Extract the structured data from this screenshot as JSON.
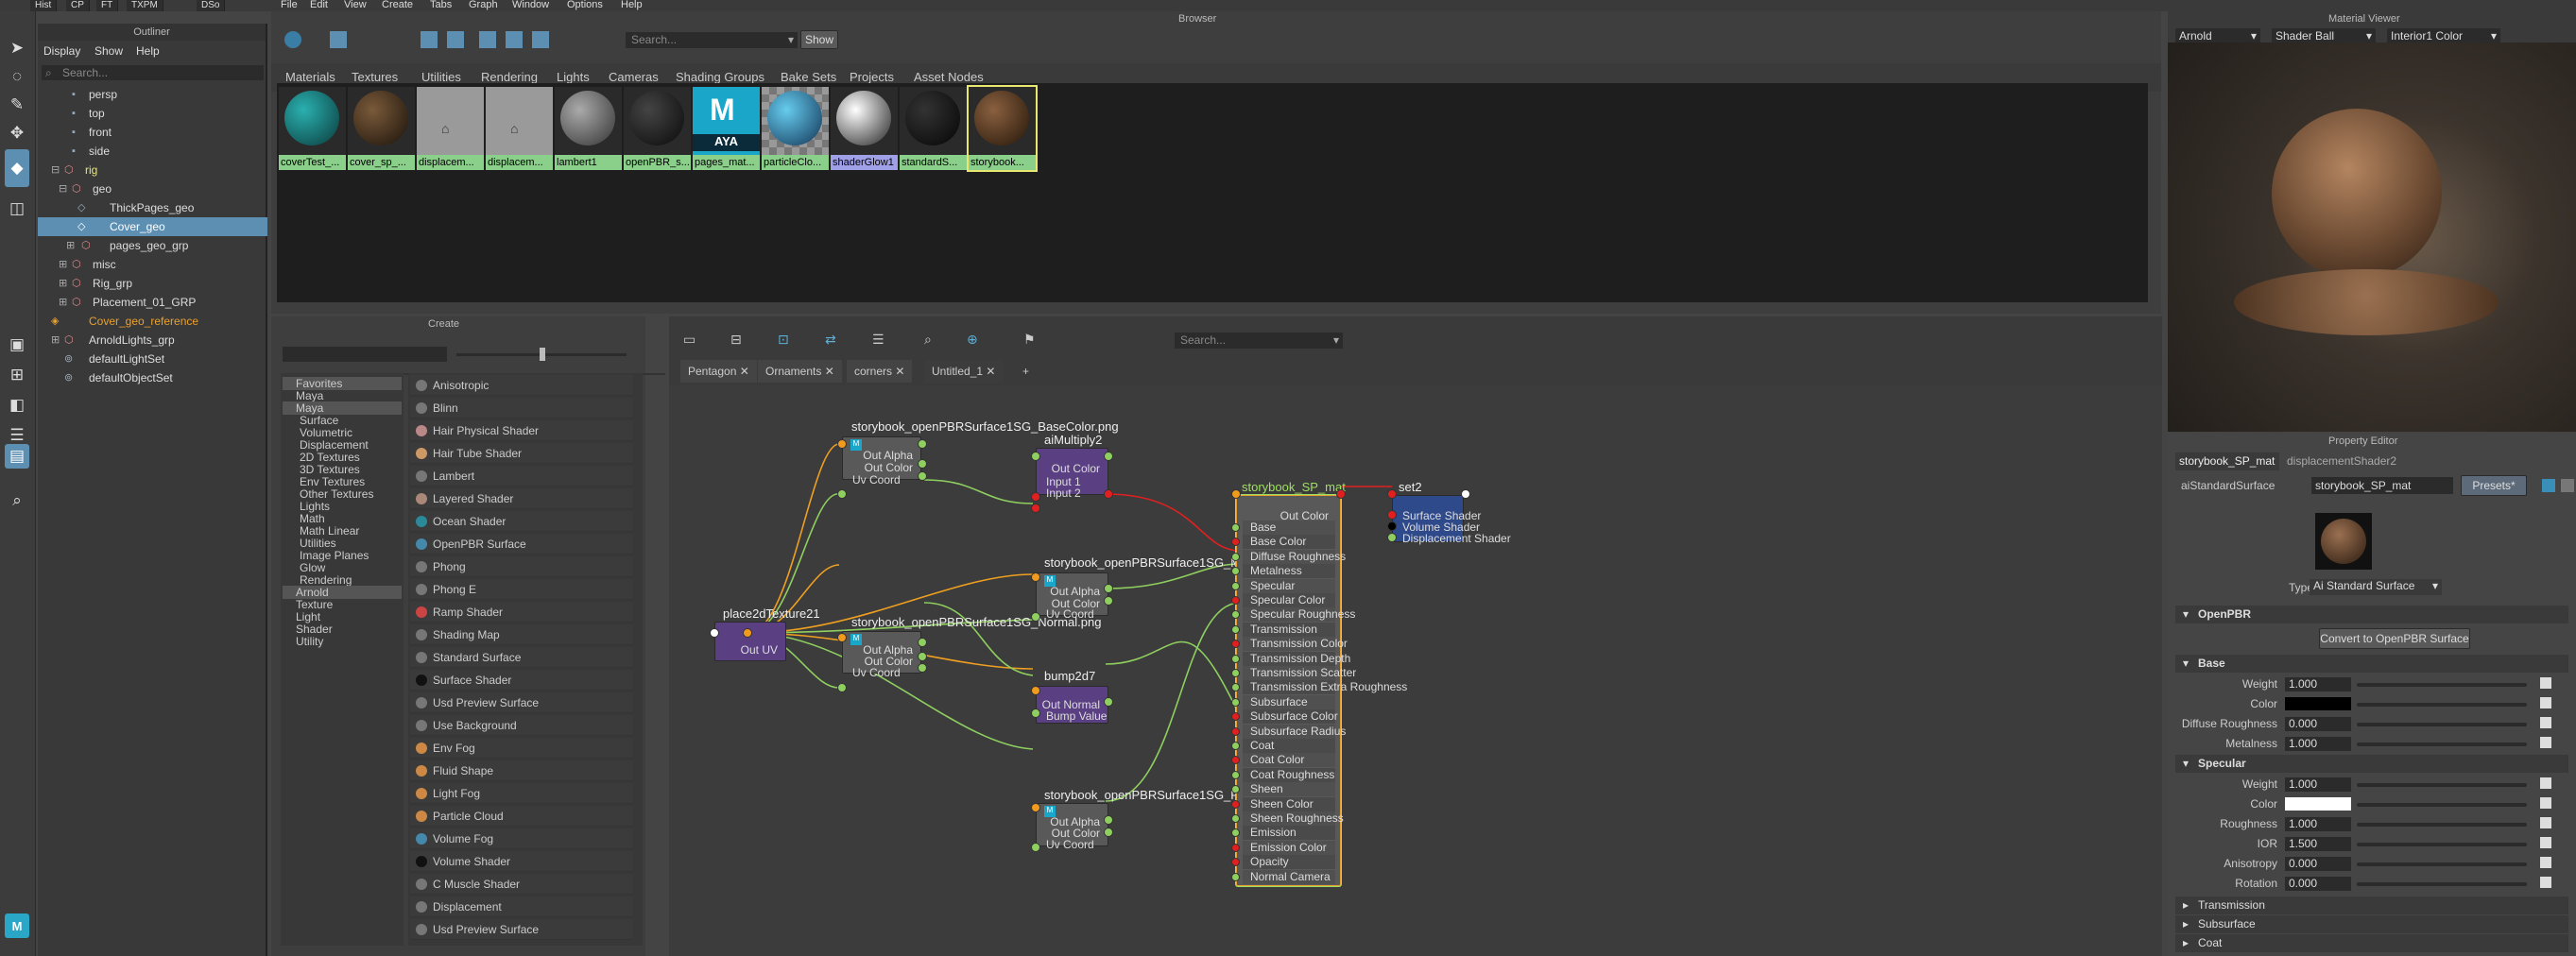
{
  "app": {
    "menu": [
      "File",
      "Edit",
      "View",
      "Create",
      "Tabs",
      "Graph",
      "Window",
      "Options",
      "Help"
    ],
    "shelf_tabs": [
      "Hist",
      "CP",
      "FT",
      "TXPM",
      "DSo"
    ]
  },
  "outliner": {
    "title": "Outliner",
    "menu": [
      "Display",
      "Show",
      "Help"
    ],
    "search_placeholder": "Search...",
    "items": [
      "persp",
      "top",
      "front",
      "side",
      "rig",
      "geo",
      "ThickPages_geo",
      "Cover_geo",
      "pages_geo_grp",
      "misc",
      "Rig_grp",
      "Placement_01_GRP",
      "Cover_geo_reference",
      "ArnoldLights_grp",
      "defaultLightSet",
      "defaultObjectSet"
    ]
  },
  "browser": {
    "title": "Browser",
    "search_placeholder": "Search...",
    "show_label": "Show",
    "tabs": [
      "Materials",
      "Textures",
      "Utilities",
      "Rendering",
      "Lights",
      "Cameras",
      "Shading Groups",
      "Bake Sets",
      "Projects",
      "Asset Nodes"
    ],
    "swatches": [
      "coverTest_...",
      "cover_sp_...",
      "displacem...",
      "displacem...",
      "lambert1",
      "openPBR_s...",
      "pages_mat...",
      "particleClo...",
      "shaderGlow1",
      "standardS...",
      "storybook..."
    ],
    "aya_label": "AYA"
  },
  "create": {
    "title": "Create",
    "tree": [
      "Favorites",
      "Maya",
      "Surface",
      "Volumetric",
      "Displacement",
      "2D Textures",
      "3D Textures",
      "Env Textures",
      "Other Textures",
      "Lights",
      "Math",
      "Math Linear",
      "Utilities",
      "Image Planes",
      "Glow",
      "Rendering",
      "Arnold",
      "Texture",
      "Light",
      "Shader",
      "Utility"
    ],
    "list": [
      "Anisotropic",
      "Blinn",
      "Hair Physical Shader",
      "Hair Tube Shader",
      "Lambert",
      "Layered Shader",
      "Ocean Shader",
      "OpenPBR Surface",
      "Phong",
      "Phong E",
      "Ramp Shader",
      "Shading Map",
      "Standard Surface",
      "Surface Shader",
      "Usd Preview Surface",
      "Use Background",
      "Env Fog",
      "Fluid Shape",
      "Light Fog",
      "Particle Cloud",
      "Volume Fog",
      "Volume Shader",
      "C Muscle Shader",
      "Displacement",
      "Usd Preview Surface"
    ]
  },
  "editor": {
    "search_placeholder": "Search...",
    "tabs": [
      "Pentagon",
      "Ornaments",
      "corners",
      "Untitled_1",
      "+"
    ],
    "nodes": {
      "basecolor": {
        "title": "storybook_openPBRSurface1SG_BaseColor.png",
        "ports": [
          "Out Alpha",
          "Out Color",
          "Uv Coord"
        ]
      },
      "multiply": {
        "title": "aiMultiply2",
        "ports": [
          "Out Color",
          "Input 1",
          "Input 2"
        ]
      },
      "metal": {
        "title": "storybook_openPBRSurface1SG_Metalness.png",
        "ports": [
          "Out Alpha",
          "Out Color",
          "Uv Coord"
        ]
      },
      "place": {
        "title": "place2dTexture21",
        "ports": [
          "Out UV"
        ]
      },
      "normal": {
        "title": "storybook_openPBRSurface1SG_Normal.png",
        "ports": [
          "Out Alpha",
          "Out Color",
          "Uv Coord"
        ]
      },
      "bump": {
        "title": "bump2d7",
        "ports": [
          "Out Normal",
          "Bump Value"
        ]
      },
      "rough": {
        "title": "storybook_openPBRSurface1SG_Roughness.png",
        "ports": [
          "Out Alpha",
          "Out Color",
          "Uv Coord"
        ]
      },
      "mat": {
        "title": "storybook_SP_mat",
        "out": "Out Color",
        "ports": [
          "Base",
          "Base Color",
          "Diffuse Roughness",
          "Metalness",
          "Specular",
          "Specular Color",
          "Specular Roughness",
          "Transmission",
          "Transmission Color",
          "Transmission Depth",
          "Transmission Scatter",
          "Transmission Extra Roughness",
          "Subsurface",
          "Subsurface Color",
          "Subsurface Radius",
          "Coat",
          "Coat Color",
          "Coat Roughness",
          "Sheen",
          "Sheen Color",
          "Sheen Roughness",
          "Emission",
          "Emission Color",
          "Opacity",
          "Normal Camera"
        ]
      },
      "set": {
        "title": "set2",
        "ports": [
          "Surface Shader",
          "Volume Shader",
          "Displacement Shader"
        ]
      }
    }
  },
  "viewer": {
    "title": "Material Viewer",
    "renderer": "Arnold",
    "shape": "Shader Ball",
    "env": "Interior1 Color"
  },
  "props": {
    "title": "Property Editor",
    "tabs": [
      "storybook_SP_mat",
      "displacementShader2"
    ],
    "node_type": "aiStandardSurface",
    "node_name": "storybook_SP_mat",
    "presets": "Presets*",
    "type_label": "Type",
    "type_value": "Ai Standard Surface",
    "openpbr_section": "OpenPBR",
    "convert_label": "Convert to OpenPBR Surface",
    "base_section": "Base",
    "base": [
      {
        "label": "Weight",
        "value": "1.000"
      },
      {
        "label": "Color",
        "value": ""
      },
      {
        "label": "Diffuse Roughness",
        "value": "0.000"
      },
      {
        "label": "Metalness",
        "value": "1.000"
      }
    ],
    "specular_section": "Specular",
    "specular": [
      {
        "label": "Weight",
        "value": "1.000"
      },
      {
        "label": "Color",
        "value": ""
      },
      {
        "label": "Roughness",
        "value": "1.000"
      },
      {
        "label": "IOR",
        "value": "1.500"
      },
      {
        "label": "Anisotropy",
        "value": "0.000"
      },
      {
        "label": "Rotation",
        "value": "0.000"
      }
    ],
    "collapsed": [
      "Transmission",
      "Subsurface",
      "Coat"
    ],
    "colors": {
      "base_color": "#000000",
      "spec_color": "#ffffff"
    }
  }
}
